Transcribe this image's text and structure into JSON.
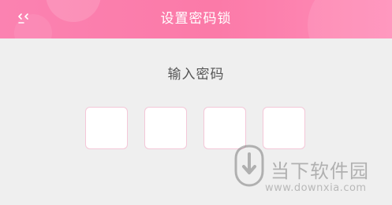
{
  "header": {
    "title": "设置密码锁",
    "background_color": "#fb7aa8",
    "back_icon": "chevron-double-left-icon"
  },
  "main": {
    "prompt": "输入密码",
    "pin_count": 4,
    "pin_border_color": "#f4c7d8",
    "pin_values": [
      "",
      "",
      "",
      ""
    ]
  },
  "watermark": {
    "logo_icon": "download-shield-logo",
    "name": "当下软件园",
    "url": "www.downxia.com"
  }
}
